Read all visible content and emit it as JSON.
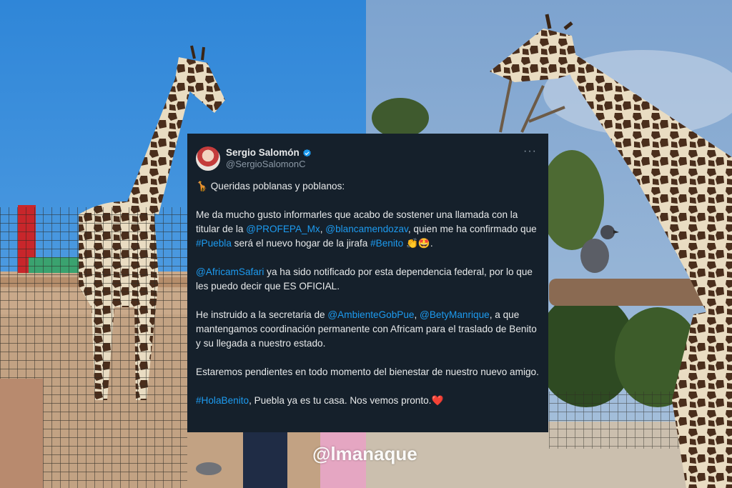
{
  "tweet": {
    "display_name": "Sergio Salomón",
    "handle": "@SergioSalomonC",
    "more_label": "···",
    "greeting_emoji": "🦒",
    "greeting": "Queridas poblanas y poblanos:",
    "p1_a": "Me da mucho gusto informarles que acabo de sostener una llamada con la titular de la ",
    "p1_mention1": "@PROFEPA_Mx",
    "p1_b": ", ",
    "p1_mention2": "@blancamendozav",
    "p1_c": ", quien me ha confirmado que ",
    "p1_hashtag1": "#Puebla",
    "p1_d": " será el nuevo hogar de la jirafa ",
    "p1_hashtag2": "#Benito",
    "p1_emoji": " 👏🤩",
    "p1_end": ".",
    "p2_mention": "@AfricamSafari",
    "p2_text": " ya ha sido notificado por esta dependencia federal, por lo que les puedo decir que ES OFICIAL.",
    "p3_a": "He instruido a la secretaria de ",
    "p3_mention1": "@AmbienteGobPue",
    "p3_b": ", ",
    "p3_mention2": "@BetyManrique",
    "p3_c": ", a que mantengamos coordinación permanente con Africam para el traslado de Benito y su llegada a nuestro estado.",
    "p4": "Estaremos pendientes en todo momento del bienestar de nuestro nuevo amigo.",
    "p5_hashtag": "#HolaBenito",
    "p5_text": ", Puebla ya es tu casa. Nos vemos pronto.",
    "p5_emoji": "❤️"
  },
  "watermark": "@lmanaque",
  "colors": {
    "card_bg": "#15202b",
    "text": "#e7e9ea",
    "link": "#1d9bf0",
    "muted": "#8b98a5"
  }
}
